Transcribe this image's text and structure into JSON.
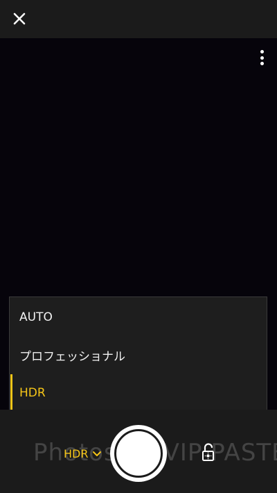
{
  "topbar": {
    "close_icon": "close-icon"
  },
  "viewfinder": {
    "more_icon": "more-vertical-icon"
  },
  "mode_menu": {
    "items": [
      {
        "label": "AUTO",
        "active": false
      },
      {
        "label": "プロフェッショナル",
        "active": false
      },
      {
        "label": "HDR",
        "active": true
      }
    ]
  },
  "bottombar": {
    "watermark": "PhotoshopVIP PASTEL",
    "current_mode": "HDR",
    "shutter_icon": "shutter-button",
    "ae_lock_icon": "ae-lock-icon"
  },
  "colors": {
    "accent": "#f5c518",
    "bar_background": "#1b1b1b",
    "menu_background": "#1e1e1e",
    "viewfinder_background": "#06040b"
  }
}
